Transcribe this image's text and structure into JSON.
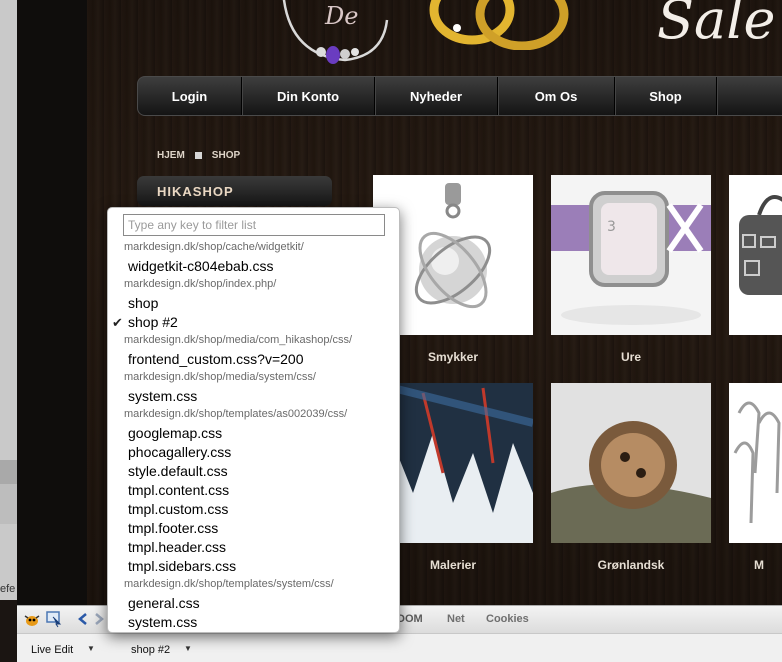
{
  "site": {
    "header_script_small": "De",
    "header_script_large": "Sale",
    "nav": [
      {
        "label": "Login"
      },
      {
        "label": "Din Konto"
      },
      {
        "label": "Nyheder"
      },
      {
        "label": "Om Os"
      },
      {
        "label": "Shop"
      },
      {
        "label": ""
      }
    ],
    "breadcrumb": {
      "home": "HJEM",
      "current": "SHOP"
    },
    "sidebar_heading": "HIKASHOP",
    "products": [
      {
        "caption": "Smykker"
      },
      {
        "caption": "Ure"
      },
      {
        "caption": ""
      },
      {
        "caption": "Malerier"
      },
      {
        "caption": "Grønlandsk"
      },
      {
        "caption": "M"
      }
    ]
  },
  "popup": {
    "filter_placeholder": "Type any key to filter list",
    "groups": [
      {
        "path": "markdesign.dk/shop/cache/widgetkit/",
        "items": [
          {
            "label": "widgetkit-c804ebab.css",
            "checked": false
          }
        ]
      },
      {
        "path": "markdesign.dk/shop/index.php/",
        "items": [
          {
            "label": "shop",
            "checked": false
          },
          {
            "label": "shop #2",
            "checked": true
          }
        ]
      },
      {
        "path": "markdesign.dk/shop/media/com_hikashop/css/",
        "items": [
          {
            "label": "frontend_custom.css?v=200",
            "checked": false
          }
        ]
      },
      {
        "path": "markdesign.dk/shop/media/system/css/",
        "items": [
          {
            "label": "system.css",
            "checked": false
          }
        ]
      },
      {
        "path": "markdesign.dk/shop/templates/as002039/css/",
        "items": [
          {
            "label": "googlemap.css",
            "checked": false
          },
          {
            "label": "phocagallery.css",
            "checked": false
          },
          {
            "label": "style.default.css",
            "checked": false
          },
          {
            "label": "tmpl.content.css",
            "checked": false
          },
          {
            "label": "tmpl.custom.css",
            "checked": false
          },
          {
            "label": "tmpl.footer.css",
            "checked": false
          },
          {
            "label": "tmpl.header.css",
            "checked": false
          },
          {
            "label": "tmpl.sidebars.css",
            "checked": false
          }
        ]
      },
      {
        "path": "markdesign.dk/shop/templates/system/css/",
        "items": [
          {
            "label": "general.css",
            "checked": false
          },
          {
            "label": "system.css",
            "checked": false
          }
        ]
      }
    ]
  },
  "firebug": {
    "tabs": {
      "dom": "DOM",
      "net": "Net",
      "cookies": "Cookies"
    },
    "status": {
      "mode": "Live Edit",
      "selected_sheet": "shop #2"
    }
  },
  "os": {
    "left_label": "efe"
  },
  "colors": {
    "nav_text": "#ffffff",
    "crumb_text": "#ded4c8",
    "heading_text": "#e9d7c2"
  }
}
